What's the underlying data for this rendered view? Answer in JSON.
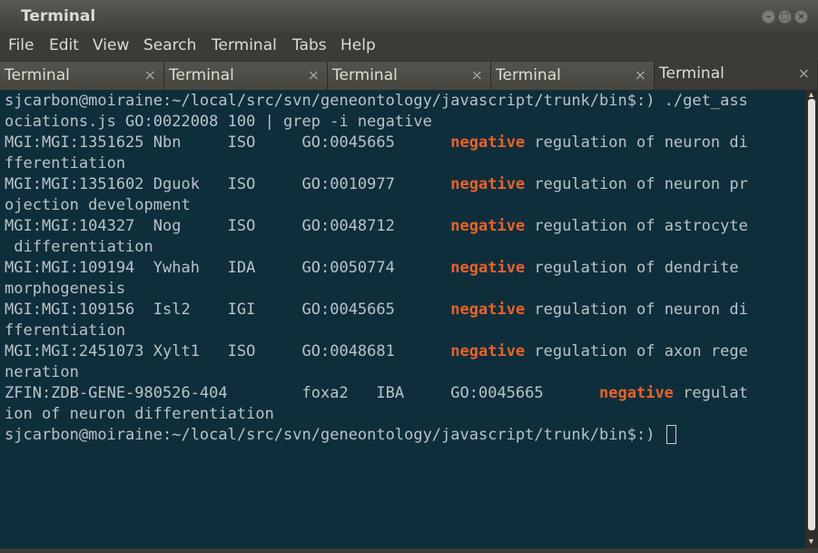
{
  "window": {
    "title": "Terminal"
  },
  "menu": [
    "File",
    "Edit",
    "View",
    "Search",
    "Terminal",
    "Tabs",
    "Help"
  ],
  "tabs": [
    {
      "label": "Terminal",
      "close": "×"
    },
    {
      "label": "Terminal",
      "close": "×"
    },
    {
      "label": "Terminal",
      "close": "×"
    },
    {
      "label": "Terminal",
      "close": "×"
    },
    {
      "label": "Terminal",
      "close": "×"
    }
  ],
  "active_tab": 4,
  "terminal": {
    "lines": [
      {
        "text": "sjcarbon@moiraine:~/local/src/svn/geneontology/javascript/trunk/bin$:) ./get_ass"
      },
      {
        "text": "ociations.js GO:0022008 100 | grep -i negative"
      },
      {
        "pre": "MGI:MGI:1351625 Nbn     ISO     GO:0045665      ",
        "hl": "negative",
        "post": " regulation of neuron di"
      },
      {
        "text": "fferentiation"
      },
      {
        "pre": "MGI:MGI:1351602 Dguok   ISO     GO:0010977      ",
        "hl": "negative",
        "post": " regulation of neuron pr"
      },
      {
        "text": "ojection development"
      },
      {
        "pre": "MGI:MGI:104327  Nog     ISO     GO:0048712      ",
        "hl": "negative",
        "post": " regulation of astrocyte"
      },
      {
        "text": " differentiation"
      },
      {
        "pre": "MGI:MGI:109194  Ywhah   IDA     GO:0050774      ",
        "hl": "negative",
        "post": " regulation of dendrite "
      },
      {
        "text": "morphogenesis"
      },
      {
        "pre": "MGI:MGI:109156  Isl2    IGI     GO:0045665      ",
        "hl": "negative",
        "post": " regulation of neuron di"
      },
      {
        "text": "fferentiation"
      },
      {
        "pre": "MGI:MGI:2451073 Xylt1   ISO     GO:0048681      ",
        "hl": "negative",
        "post": " regulation of axon rege"
      },
      {
        "text": "neration"
      },
      {
        "pre": "ZFIN:ZDB-GENE-980526-404        foxa2   IBA     GO:0045665      ",
        "hl": "negative",
        "post": " regulat"
      },
      {
        "text": "ion of neuron differentiation"
      },
      {
        "text": "sjcarbon@moiraine:~/local/src/svn/geneontology/javascript/trunk/bin$:) ",
        "cursor": true
      }
    ]
  },
  "icons": {
    "minimize": "minimize-icon",
    "maximize": "maximize-icon",
    "close": "close-icon"
  }
}
